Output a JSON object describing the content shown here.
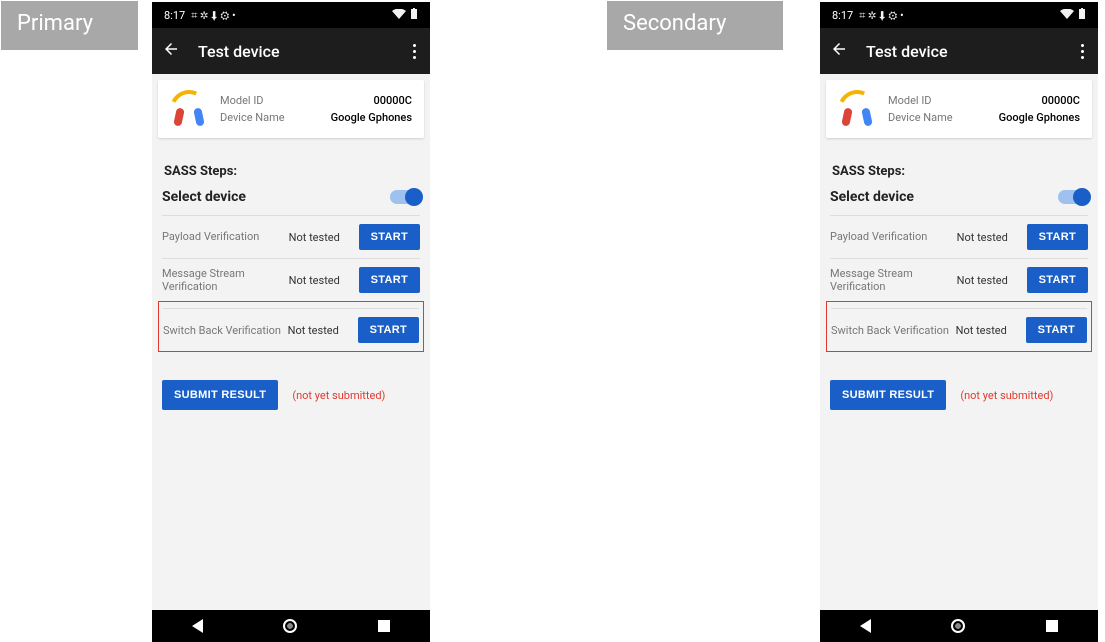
{
  "labels": {
    "primary": "Primary",
    "secondary": "Secondary"
  },
  "status": {
    "time": "8:17",
    "icons_left": "⌗ ✲ ⬇ ⚙ •",
    "wifi": "▾",
    "batt": "▮"
  },
  "appbar": {
    "title": "Test device"
  },
  "device": {
    "model_key": "Model ID",
    "model_val": "00000C",
    "name_key": "Device Name",
    "name_val": "Google Gphones"
  },
  "sass_heading": "SASS Steps:",
  "select_label": "Select device",
  "tests": [
    {
      "name": "Payload Verification",
      "status": "Not tested",
      "btn": "START"
    },
    {
      "name": "Message Stream Verification",
      "status": "Not tested",
      "btn": "START"
    },
    {
      "name": "Switch Back Verification",
      "status": "Not tested",
      "btn": "START"
    }
  ],
  "submit_btn": "SUBMIT RESULT",
  "not_submitted": "(not yet submitted)"
}
